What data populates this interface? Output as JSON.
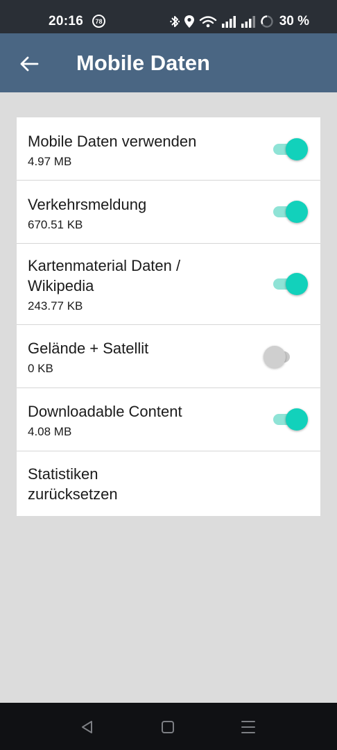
{
  "status_bar": {
    "time": "20:16",
    "badge": "78",
    "battery": "30 %",
    "icons": [
      "bluetooth-icon",
      "location-icon",
      "wifi-icon",
      "signal-icon",
      "signal-icon",
      "battery-ring-icon"
    ]
  },
  "app_bar": {
    "back_icon": "arrow-left-icon",
    "title": "Mobile Daten",
    "color": "#4a6683"
  },
  "settings": [
    {
      "title_lines": [
        "Mobile Daten verwenden"
      ],
      "subtitle": "4.97 MB",
      "toggle": true
    },
    {
      "title_lines": [
        "Verkehrsmeldung"
      ],
      "subtitle": "670.51 KB",
      "toggle": true
    },
    {
      "title_lines": [
        "Kartenmaterial Daten /",
        "Wikipedia"
      ],
      "subtitle": "243.77 KB",
      "toggle": true
    },
    {
      "title_lines": [
        "Gelände + Satellit"
      ],
      "subtitle": "0 KB",
      "toggle": false
    },
    {
      "title_lines": [
        "Downloadable Content"
      ],
      "subtitle": "4.08 MB",
      "toggle": true
    },
    {
      "title_lines": [
        "Statistiken",
        "zurücksetzen"
      ],
      "subtitle": null,
      "toggle": null
    }
  ],
  "colors": {
    "accent": "#12d1bb",
    "accent_track": "#8fe3d6",
    "background": "#dcdcdc"
  },
  "nav_bar": {
    "icons": [
      "back-triangle-icon",
      "home-square-icon",
      "menu-lines-icon"
    ]
  }
}
